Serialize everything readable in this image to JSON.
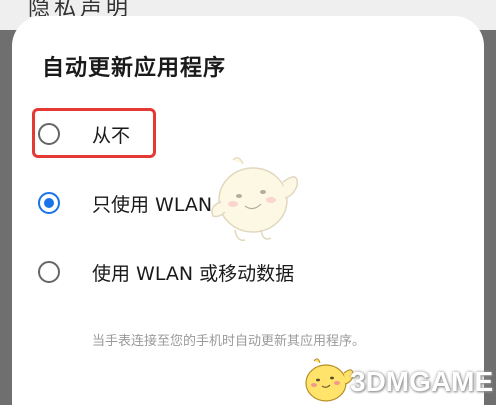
{
  "background": {
    "text": "隐私声明"
  },
  "dialog": {
    "title": "自动更新应用程序",
    "options": [
      {
        "label": "从不",
        "checked": false
      },
      {
        "label": "只使用 WLAN",
        "checked": true
      },
      {
        "label": "使用 WLAN 或移动数据",
        "checked": false
      }
    ],
    "footnote": "当手表连接至您的手机时自动更新其应用程序。"
  },
  "watermark": {
    "text": "3DMGAME"
  },
  "colors": {
    "accent": "#1a73e8",
    "highlight": "#e53935"
  }
}
